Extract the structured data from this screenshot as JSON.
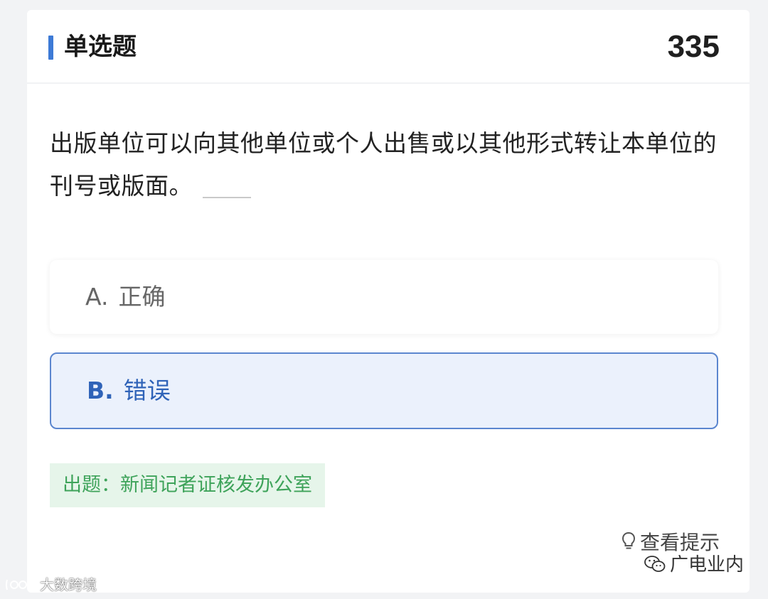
{
  "header": {
    "question_type": "单选题",
    "question_number": "335"
  },
  "question": {
    "text": "出版单位可以向其他单位或个人出售或以其他形式转让本单位的刊号或版面。"
  },
  "options": [
    {
      "letter": "A.",
      "label": "正确",
      "selected": false
    },
    {
      "letter": "B.",
      "label": "错误",
      "selected": true
    }
  ],
  "source": {
    "text": "出题：新闻记者证核发办公室"
  },
  "hint": {
    "label": "查看提示",
    "icon": "lightbulb-icon"
  },
  "watermarks": {
    "left": "大数跨境",
    "right": "广电业内"
  },
  "colors": {
    "accent": "#3d7ad6",
    "selected_bg": "#ebf1fc",
    "selected_border": "#5b86cf",
    "source_bg": "#e6f5ea",
    "source_text": "#3ea35a"
  }
}
